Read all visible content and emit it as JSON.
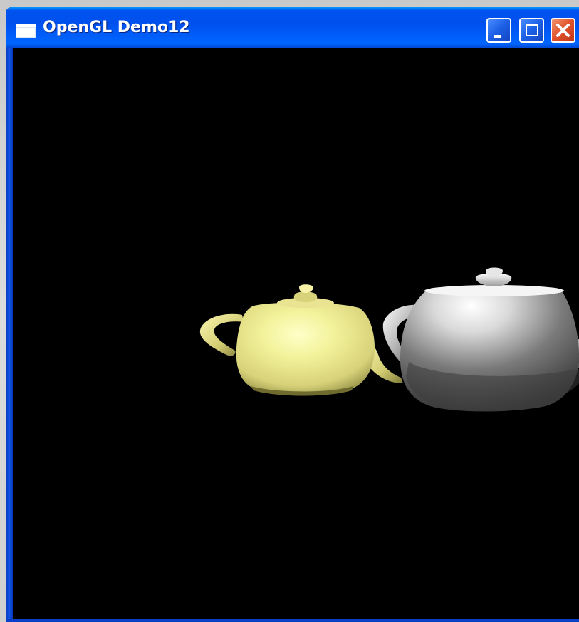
{
  "window": {
    "title": "OpenGL Demo12",
    "icon": "application-window-icon",
    "buttons": {
      "minimize": "minimize-icon",
      "maximize": "maximize-icon",
      "close": "close-icon"
    }
  },
  "scene": {
    "background_color": "#000000",
    "objects": [
      {
        "name": "teapot-yellow",
        "color": "#ecec8e"
      },
      {
        "name": "teapot-gray",
        "color": "#9a9a9a"
      }
    ]
  },
  "colors": {
    "titlebar": "#0053ee",
    "close_button": "#e0502a"
  }
}
